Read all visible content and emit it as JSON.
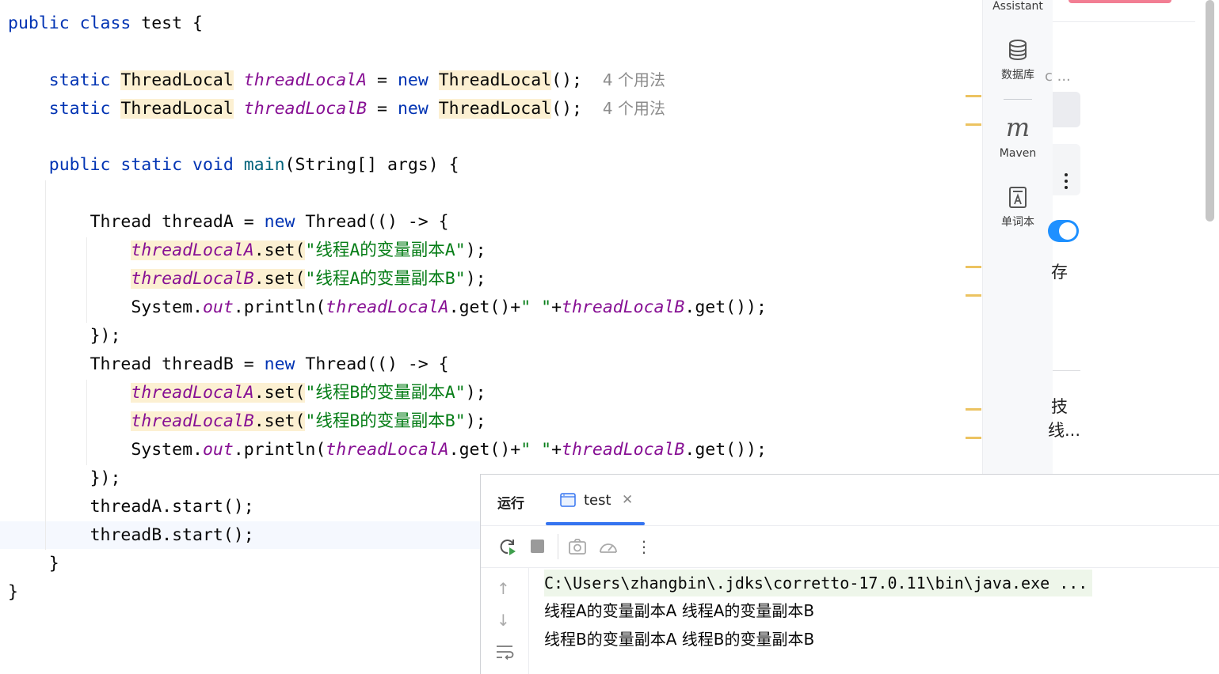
{
  "code": {
    "line1": {
      "kw": "public class",
      "rest": " test {"
    },
    "line2": {
      "kw1": "static",
      "type1": "ThreadLocal",
      "field": "threadLocalA",
      "eq": " = ",
      "kw2": "new",
      "type2": "ThreadLocal",
      "end": "();",
      "usages": "4 个用法"
    },
    "line3": {
      "kw1": "static",
      "type1": "ThreadLocal",
      "field": "threadLocalB",
      "eq": " = ",
      "kw2": "new",
      "type2": "ThreadLocal",
      "end": "();",
      "usages": "4 个用法"
    },
    "line4": {
      "kw": "public static void",
      "method": "main",
      "rest": "(String[] args) {"
    },
    "line5": {
      "pre": "Thread threadA = ",
      "kw": "new",
      "post": " Thread(() -> {"
    },
    "line6": {
      "field": "threadLocalA",
      "mid": ".set(",
      "str": "\"线程A的变量副本A\"",
      "end": ");"
    },
    "line7": {
      "field": "threadLocalB",
      "mid": ".set(",
      "str": "\"线程A的变量副本B\"",
      "end": ");"
    },
    "line8": {
      "pre": "System.",
      "out": "out",
      "mid": ".println(",
      "fa": "threadLocalA",
      "mid2": ".get()+",
      "str": "\" \"",
      "plus": "+",
      "fb": "threadLocalB",
      "end": ".get());"
    },
    "line9": "});",
    "line10": {
      "pre": "Thread threadB = ",
      "kw": "new",
      "post": " Thread(() -> {"
    },
    "line11": {
      "field": "threadLocalA",
      "mid": ".set(",
      "str": "\"线程B的变量副本A\"",
      "end": ");"
    },
    "line12": {
      "field": "threadLocalB",
      "mid": ".set(",
      "str": "\"线程B的变量副本B\"",
      "end": ");"
    },
    "line13": {
      "pre": "System.",
      "out": "out",
      "mid": ".println(",
      "fa": "threadLocalA",
      "mid2": ".get()+",
      "str": "\" \"",
      "plus": "+",
      "fb": "threadLocalB",
      "end": ".get());"
    },
    "line14": "});",
    "line15": "threadA.start();",
    "line16": "threadB.start();",
    "line17": "}",
    "line18": "}"
  },
  "toolstrip": {
    "assistant_label": "Assistant",
    "database_label": "数据库",
    "maven_label": "Maven",
    "maven_glyph": "m",
    "wordbook_label": "单词本"
  },
  "right_panel": {
    "fragment1": "c ...",
    "fragment2": "存",
    "fragment3": "技",
    "fragment4": "线..."
  },
  "run_panel": {
    "title": "运行",
    "tab_label": "test",
    "console_cmd": "C:\\Users\\zhangbin\\.jdks\\corretto-17.0.11\\bin\\java.exe ...",
    "console_out1": "线程A的变量副本A 线程A的变量副本B",
    "console_out2": "线程B的变量副本A 线程B的变量副本B"
  },
  "colors": {
    "keyword": "#0033b3",
    "field": "#871094",
    "string": "#067d17",
    "usage_highlight": "#fcf0d2",
    "accent": "#3574f0",
    "toggle": "#1e90ff"
  }
}
